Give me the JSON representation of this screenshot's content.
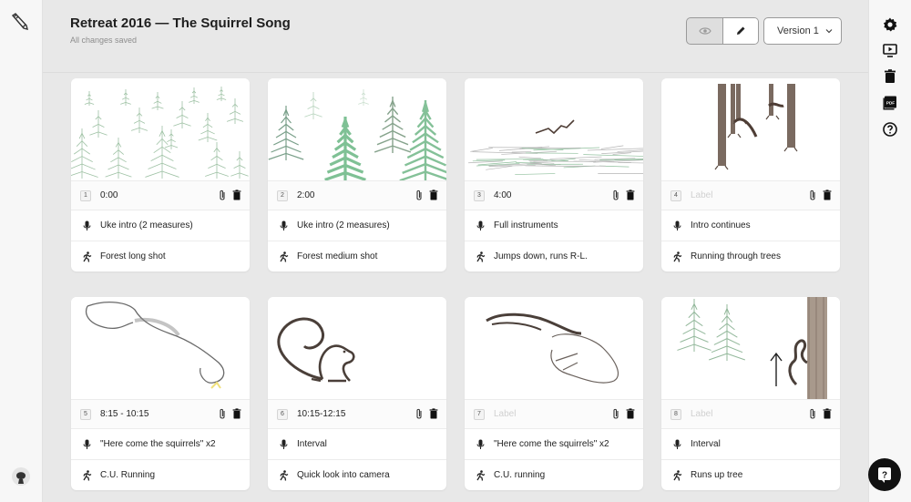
{
  "app": {
    "title": "Retreat 2016 — The Squirrel Song",
    "save_status": "All changes saved",
    "version": "Version 1",
    "view_mode": "edit"
  },
  "left_rail": {
    "logo_icon": "pencil-icon",
    "avatar_icon": "user-avatar"
  },
  "right_rail": {
    "items": [
      {
        "name": "settings",
        "icon": "gear-icon"
      },
      {
        "name": "present",
        "icon": "play-slideshow-icon"
      },
      {
        "name": "delete",
        "icon": "trash-icon"
      },
      {
        "name": "export-pdf",
        "icon": "pdf-icon"
      },
      {
        "name": "help",
        "icon": "question-icon"
      }
    ]
  },
  "panels": [
    {
      "number": "1",
      "time": "0:00",
      "time_placeholder": false,
      "audio": "Uke intro (2 measures)",
      "action": "Forest long shot",
      "sketch": "forest-long"
    },
    {
      "number": "2",
      "time": "2:00",
      "time_placeholder": false,
      "audio": "Uke intro (2 measures)",
      "action": "Forest medium shot",
      "sketch": "forest-medium"
    },
    {
      "number": "3",
      "time": "4:00",
      "time_placeholder": false,
      "audio": "Full instruments",
      "action": "Jumps down, runs R-L.",
      "sketch": "forest-floor"
    },
    {
      "number": "4",
      "time": "Label",
      "time_placeholder": true,
      "audio": "Intro continues",
      "action": "Running through trees",
      "sketch": "tree-trunks"
    },
    {
      "number": "5",
      "time": "8:15 - 10:15",
      "time_placeholder": false,
      "audio": "\"Here come the squirrels\" x2",
      "action": "C.U. Running",
      "sketch": "squirrel-running"
    },
    {
      "number": "6",
      "time": "10:15-12:15",
      "time_placeholder": false,
      "audio": "Interval",
      "action": "Quick look into camera",
      "sketch": "squirrel-sitting"
    },
    {
      "number": "7",
      "time": "Label",
      "time_placeholder": true,
      "audio": "\"Here come the squirrels\" x2",
      "action": "C.U. running",
      "sketch": "squirrel-leaping"
    },
    {
      "number": "8",
      "time": "Label",
      "time_placeholder": true,
      "audio": "Interval",
      "action": "Runs up tree",
      "sketch": "squirrel-climbing"
    }
  ],
  "colors": {
    "background": "#e8e8e8",
    "card": "#ffffff",
    "sketch_green": "#8fbf9c",
    "sketch_brown": "#6d5f55"
  }
}
